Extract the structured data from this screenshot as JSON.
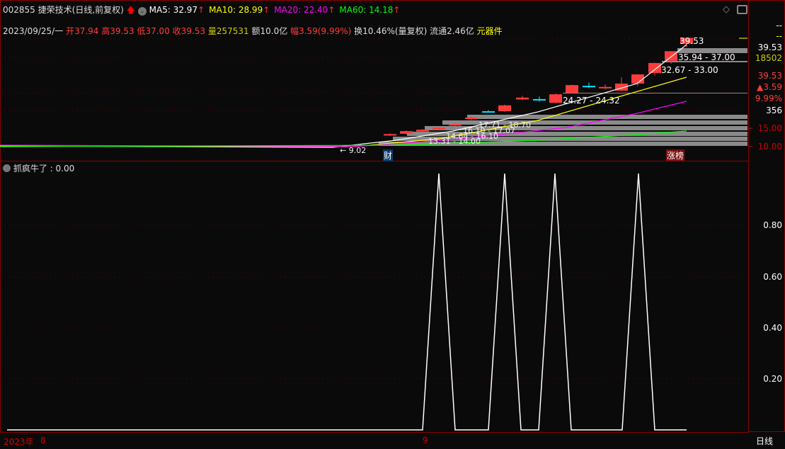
{
  "header": {
    "code": "002855",
    "name": "捷荣技术",
    "mode": "(日线,前复权)",
    "ma": [
      {
        "label": "MA5: 32.97",
        "color": "#ffffff"
      },
      {
        "label": "MA10: 28.99",
        "color": "#ffff00"
      },
      {
        "label": "MA20: 22.40",
        "color": "#ff00ff"
      },
      {
        "label": "MA60: 14.18",
        "color": "#00ff00"
      }
    ]
  },
  "info": {
    "date": "2023/09/25/一",
    "open_l": "开",
    "open": "37.94",
    "high_l": "高",
    "high": "39.53",
    "low_l": "低",
    "low": "37.00",
    "close_l": "收",
    "close": "39.53",
    "vol_l": "量",
    "vol": "257531",
    "amount": "额10.0亿",
    "chg_l": "幅",
    "chg": "3.59(9.99%)",
    "turnover": "换10.46%(量复权)",
    "float": "流通2.46亿",
    "sector": "元器件"
  },
  "price_axis": {
    "a": "--",
    "b": "--",
    "c": "39.53",
    "d": "18502",
    "e": "39.53",
    "f": "▲3.59",
    "g": "9.99%",
    "h": "356",
    "i": "15.00",
    "j": "10.00"
  },
  "annotations": [
    "39.53",
    "35.94 - 37.00",
    "32.67 - 33.00",
    "24.27 - 24.32",
    "17.71 - 18.70",
    "16.10 - 17.07",
    "14.64 - 16.10",
    "13.31 - 14.00",
    "9.02"
  ],
  "badges": {
    "cai": "财",
    "zhangbang": "涨榜"
  },
  "indicator": {
    "title": "抓疯牛了 : 0.00",
    "axis": [
      "0.80",
      "0.60",
      "0.40",
      "0.20"
    ],
    "values": [
      0,
      1,
      0,
      1,
      0,
      1,
      0,
      1,
      0
    ]
  },
  "time_axis": {
    "year": "2023年",
    "m8": "8",
    "m9": "9",
    "period": "日线"
  },
  "colors": {
    "up": "#ff3c3c",
    "down": "#00e5ff",
    "grid": "#8b0000"
  }
}
